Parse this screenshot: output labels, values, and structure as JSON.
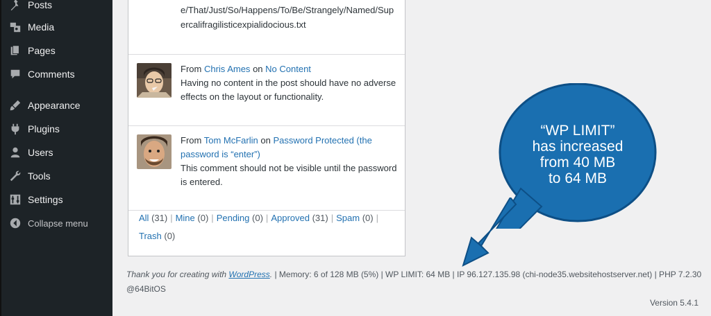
{
  "sidebar": {
    "items": [
      {
        "label": "Posts",
        "icon": "pin-icon"
      },
      {
        "label": "Media",
        "icon": "media-icon"
      },
      {
        "label": "Pages",
        "icon": "pages-icon"
      },
      {
        "label": "Comments",
        "icon": "comment-icon"
      },
      {
        "label": "Appearance",
        "icon": "brush-icon"
      },
      {
        "label": "Plugins",
        "icon": "plugin-icon"
      },
      {
        "label": "Users",
        "icon": "user-icon"
      },
      {
        "label": "Tools",
        "icon": "wrench-icon"
      },
      {
        "label": "Settings",
        "icon": "settings-icon"
      }
    ],
    "collapse": "Collapse menu"
  },
  "comments": {
    "first_text": "e/That/Just/So/Happens/To/Be/Strangely/Named/Supercalifragilisticexpialidocious.txt",
    "items": [
      {
        "from": "From",
        "author": "Chris Ames",
        "on": "on",
        "post": "No Content",
        "text": "Having no content in the post should have no adverse effects on the layout or functionality."
      },
      {
        "from": "From",
        "author": "Tom McFarlin",
        "on": "on",
        "post": "Password Protected (the password is “enter”)",
        "text": "This comment should not be visible until the password is entered."
      }
    ],
    "filters": [
      {
        "label": "All",
        "count": "(31)"
      },
      {
        "label": "Mine",
        "count": "(0)"
      },
      {
        "label": "Pending",
        "count": "(0)"
      },
      {
        "label": "Approved",
        "count": "(31)"
      },
      {
        "label": "Spam",
        "count": "(0)"
      },
      {
        "label": "Trash",
        "count": "(0)"
      }
    ]
  },
  "footer": {
    "thanks_prefix": "Thank you for creating with",
    "thanks_link": "WordPress",
    "thanks_suffix": ".",
    "stats": " | Memory: 6 of 128 MB (5%) | WP LIMIT: 64 MB | IP 96.127.135.98 (chi-node35.websitehostserver.net) | PHP 7.2.30 @64BitOS",
    "version": "Version 5.4.1"
  },
  "callout": {
    "line1": "“WP LIMIT”",
    "line2": "has increased",
    "line3": "from 40 MB",
    "line4": "to 64 MB",
    "color": "#1a6fb0"
  }
}
